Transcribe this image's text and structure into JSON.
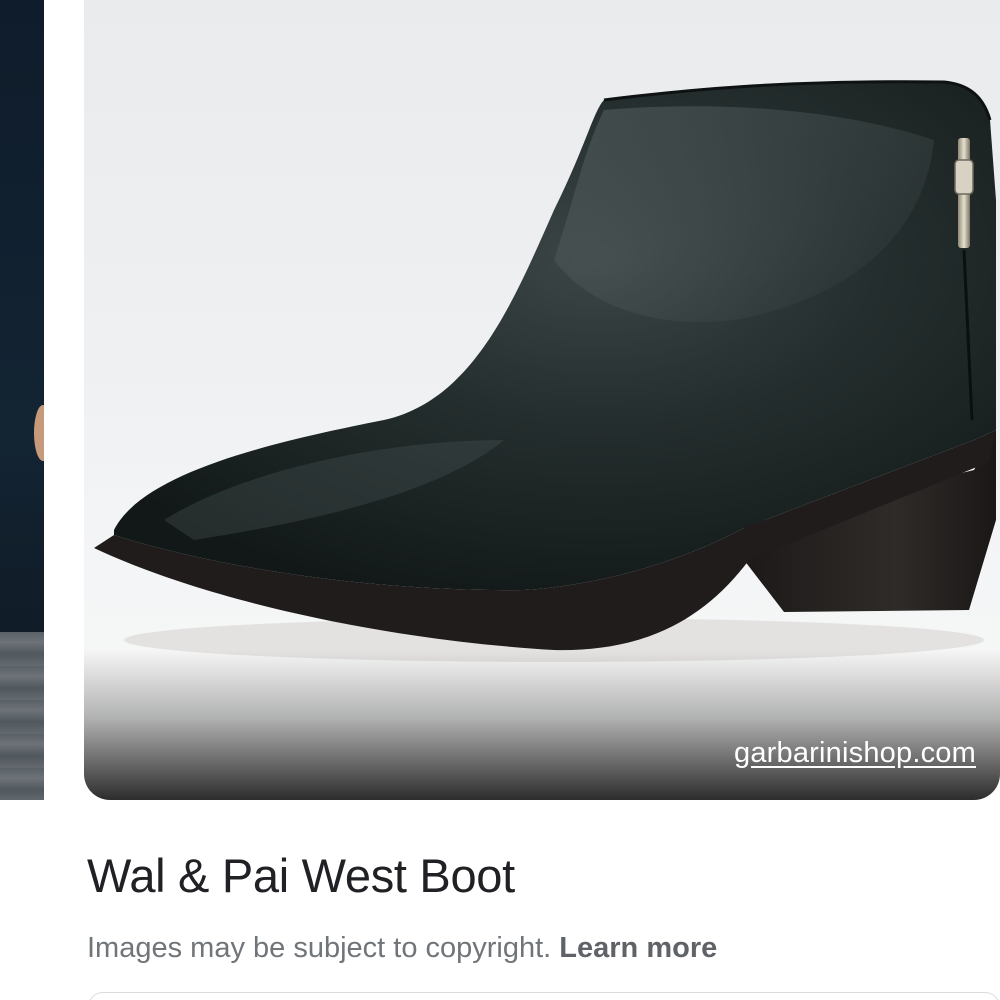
{
  "result": {
    "image_alt": "Wal & Pai West Boot",
    "source_domain": "garbarinishop.com",
    "title": "Wal & Pai West Boot"
  },
  "notice": {
    "text": "Images may be subject to copyright.",
    "learn_more_label": "Learn more"
  },
  "colors": {
    "boot_leather": "#1c2424",
    "heel": "#2a2624",
    "background": "#eef0f2",
    "title_text": "#202124",
    "muted_text": "#70757a"
  },
  "icons": {
    "image": "boot-photo"
  }
}
